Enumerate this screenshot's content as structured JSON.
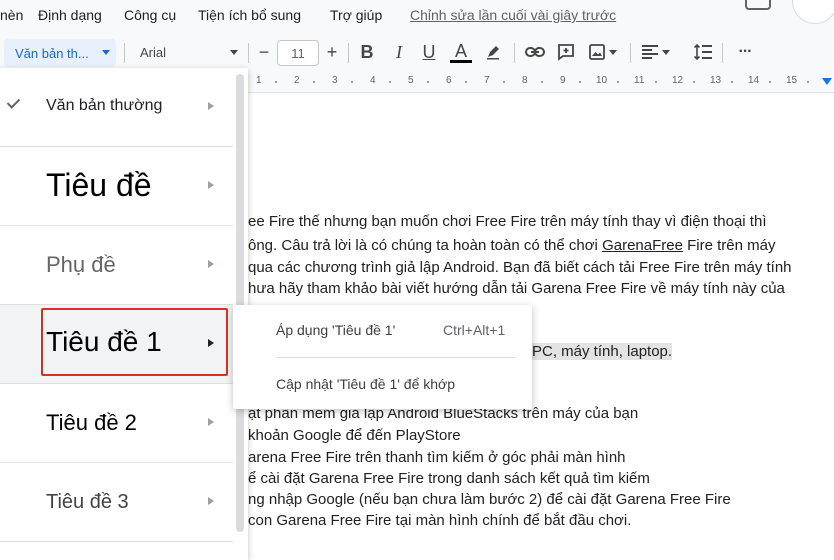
{
  "menubar": {
    "items": [
      "nèn",
      "Định dạng",
      "Công cụ",
      "Tiện ích bổ sung",
      "Trợ giúp"
    ],
    "last_edit": "Chỉnh sửa lần cuối vài giây trước"
  },
  "toolbar": {
    "style_value": "Văn bản th...",
    "font_value": "Arial",
    "minus": "−",
    "font_size": "11",
    "plus": "+",
    "bold": "B",
    "italic": "I",
    "underline": "U",
    "text_color": "A",
    "more": "···",
    "text_color_value": "#000000"
  },
  "ruler": {
    "ticks": [
      "1",
      "2",
      "3",
      "4",
      "5",
      "6",
      "7",
      "8",
      "9",
      "10",
      "11",
      "12",
      "13",
      "14",
      "15"
    ]
  },
  "style_menu": {
    "items": [
      {
        "label": "Văn bản thường",
        "checked": true
      },
      {
        "label": "Tiêu đề"
      },
      {
        "label": "Phụ đề"
      },
      {
        "label": "Tiêu đề 1",
        "highlighted": true
      },
      {
        "label": "Tiêu đề 2"
      },
      {
        "label": "Tiêu đề 3"
      }
    ]
  },
  "submenu": {
    "apply": "Áp dụng 'Tiêu đề 1'",
    "apply_shortcut": "Ctrl+Alt+1",
    "update": "Cập nhật 'Tiêu đề 1' để khớp"
  },
  "document": {
    "p1": {
      "l1": "ee Fire thế nhưng bạn muốn chơi  Free Fire trên máy tính thay vì điện thoại thì",
      "l2a": "ông. Câu trả lời là có chúng ta hoàn toàn có thể chơi ",
      "l2b": "GarenaFree",
      "l2c": " Fire trên máy",
      "l3": "qua các chương trình giả lập Android. Bạn đã biết cách tải Free Fire trên máy tính",
      "l4": "hưa hãy tham khảo bài viết hướng dẫn tải Garena Free Fire về máy tính này của"
    },
    "heading_tail": "PC, máy tính, laptop.",
    "steps": [
      "ặt phần mềm giả lập Android BlueStacks trên máy của bạn",
      " khoản Google để đến PlayStore",
      "arena Free Fire trên thanh tìm kiếm ở góc phải màn hình",
      "ể cài đặt Garena Free Fire trong danh sách kết quả tìm kiếm",
      "ng nhập Google (nếu bạn chưa làm bước 2) để cài đặt Garena Free Fire",
      "con Garena Free Fire tại màn hình chính để bắt đầu chơi."
    ]
  }
}
